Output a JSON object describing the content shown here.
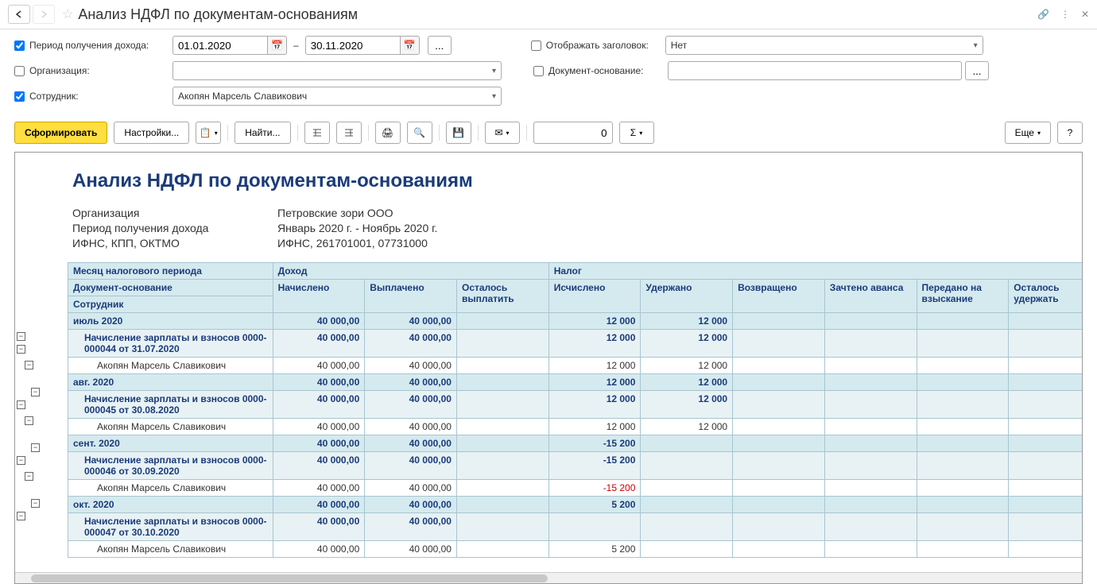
{
  "title": "Анализ НДФЛ по документам-основаниям",
  "filters": {
    "period_label": "Период получения дохода:",
    "date_from": "01.01.2020",
    "date_to": "30.11.2020",
    "show_header_label": "Отображать заголовок:",
    "show_header_value": "Нет",
    "org_label": "Организация:",
    "doc_label": "Документ-основание:",
    "employee_label": "Сотрудник:",
    "employee_value": "Акопян Марсель Славикович"
  },
  "toolbar": {
    "generate": "Сформировать",
    "settings": "Настройки...",
    "find": "Найти...",
    "more": "Еще",
    "num_value": "0"
  },
  "report": {
    "title": "Анализ НДФЛ по документам-основаниям",
    "meta": [
      {
        "label": "Организация",
        "value": "Петровские зори ООО"
      },
      {
        "label": "Период получения дохода",
        "value": "Январь 2020 г. - Ноябрь 2020 г."
      },
      {
        "label": "ИФНС, КПП, ОКТМО",
        "value": "ИФНС, 261701001, 07731000"
      }
    ],
    "headers": {
      "group1": "Месяц налогового периода",
      "group2": "Документ-основание",
      "group3": "Сотрудник",
      "income": "Доход",
      "tax": "Налог",
      "cols": [
        "Начислено",
        "Выплачено",
        "Осталось выплатить",
        "Исчислено",
        "Удержано",
        "Возвращено",
        "Зачтено аванса",
        "Передано на взыскание",
        "Осталось удержать"
      ]
    },
    "rows": [
      {
        "type": "month",
        "label": "июль 2020",
        "v": [
          "40 000,00",
          "40 000,00",
          "",
          "12 000",
          "12 000",
          "",
          "",
          "",
          ""
        ]
      },
      {
        "type": "doc",
        "label": "Начисление зарплаты и взносов 0000-000044 от 31.07.2020",
        "v": [
          "40 000,00",
          "40 000,00",
          "",
          "12 000",
          "12 000",
          "",
          "",
          "",
          ""
        ]
      },
      {
        "type": "emp",
        "label": "Акопян Марсель Славикович",
        "v": [
          "40 000,00",
          "40 000,00",
          "",
          "12 000",
          "12 000",
          "",
          "",
          "",
          ""
        ]
      },
      {
        "type": "month",
        "label": "авг. 2020",
        "v": [
          "40 000,00",
          "40 000,00",
          "",
          "12 000",
          "12 000",
          "",
          "",
          "",
          ""
        ]
      },
      {
        "type": "doc",
        "label": "Начисление зарплаты и взносов 0000-000045 от 30.08.2020",
        "v": [
          "40 000,00",
          "40 000,00",
          "",
          "12 000",
          "12 000",
          "",
          "",
          "",
          ""
        ]
      },
      {
        "type": "emp",
        "label": "Акопян Марсель Славикович",
        "v": [
          "40 000,00",
          "40 000,00",
          "",
          "12 000",
          "12 000",
          "",
          "",
          "",
          ""
        ]
      },
      {
        "type": "month",
        "label": "сент. 2020",
        "v": [
          "40 000,00",
          "40 000,00",
          "",
          "-15 200",
          "",
          "",
          "",
          "",
          ""
        ],
        "neg": [
          3
        ]
      },
      {
        "type": "doc",
        "label": "Начисление зарплаты и взносов 0000-000046 от 30.09.2020",
        "v": [
          "40 000,00",
          "40 000,00",
          "",
          "-15 200",
          "",
          "",
          "",
          "",
          ""
        ],
        "neg": [
          3
        ]
      },
      {
        "type": "emp",
        "label": "Акопян Марсель Славикович",
        "v": [
          "40 000,00",
          "40 000,00",
          "",
          "-15 200",
          "",
          "",
          "",
          "",
          ""
        ],
        "neg": [
          3
        ]
      },
      {
        "type": "month",
        "label": "окт. 2020",
        "v": [
          "40 000,00",
          "40 000,00",
          "",
          "5 200",
          "",
          "",
          "",
          "",
          ""
        ]
      },
      {
        "type": "doc",
        "label": "Начисление зарплаты и взносов 0000-000047 от 30.10.2020",
        "v": [
          "40 000,00",
          "40 000,00",
          "",
          "",
          "",
          "",
          "",
          "",
          ""
        ]
      },
      {
        "type": "emp",
        "label": "Акопян Марсель Славикович",
        "v": [
          "40 000,00",
          "40 000,00",
          "",
          "5 200",
          "",
          "",
          "",
          "",
          ""
        ]
      }
    ]
  }
}
